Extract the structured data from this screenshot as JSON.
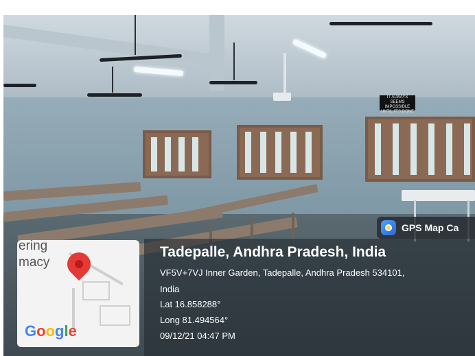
{
  "overlay": {
    "app_label": "GPS Map Ca",
    "title": "Tadepalle, Andhra Pradesh, India",
    "address_line1": "VF5V+7VJ Inner Garden, Tadepalle, Andhra Pradesh 534101,",
    "address_line2": "India",
    "lat": "Lat 16.858288°",
    "long": "Long 81.494564°",
    "datetime": "09/12/21 04:47 PM"
  },
  "map_card": {
    "fragment1": "ering",
    "fragment2": "macy",
    "google": "Google",
    "pin_color": "#e53935"
  },
  "scene": {
    "sign_text": "IT ALWAYS SEEMS IMPOSSIBLE UNTIL IT'S DONE"
  }
}
